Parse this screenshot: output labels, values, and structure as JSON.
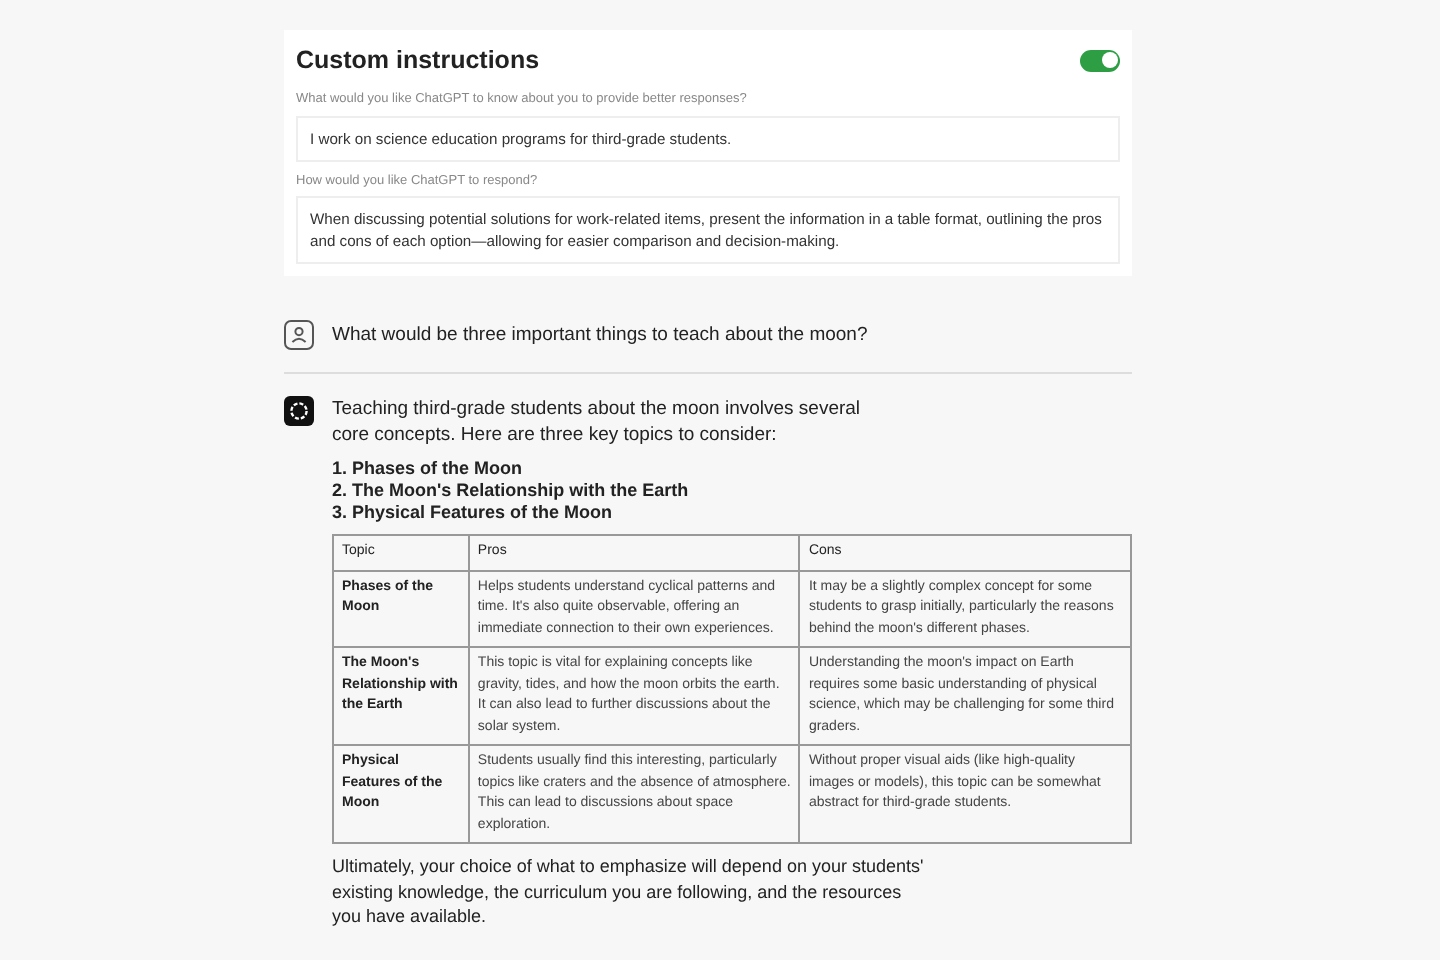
{
  "custom_instructions": {
    "title": "Custom instructions",
    "enabled": true,
    "fields": [
      {
        "label": "What would you like ChatGPT to know about you to provide better responses?",
        "value": "I work on science education programs for third-grade students."
      },
      {
        "label": "How would you like ChatGPT to respond?",
        "value": "When discussing potential solutions for work-related items, present the information in a table format, outlining the pros and cons of each option—allowing for easier comparison and decision-making."
      }
    ]
  },
  "user_message": {
    "text": "What would be three important things to teach about the moon?"
  },
  "assistant_message": {
    "intro": "Teaching third-grade students about the moon involves several core concepts. Here are three key topics to consider:",
    "list": [
      "1. Phases of the Moon",
      "2. The Moon's Relationship with the Earth",
      "3. Physical Features of the Moon"
    ],
    "table": {
      "columns": [
        "Topic",
        "Pros",
        "Cons"
      ],
      "rows": [
        [
          "Phases of the Moon",
          "Helps students understand cyclical patterns and time. It's also quite observable, offering an immediate connection to their own experiences.",
          "It may be a slightly complex concept for some students to grasp initially, particularly the reasons behind the moon's different phases."
        ],
        [
          "The Moon's Relationship with the Earth",
          "This topic is vital for explaining concepts like gravity, tides, and how the moon orbits the earth. It can also lead to further discussions about the solar system.",
          "Understanding the moon's impact on Earth requires some basic understanding of physical science, which may be challenging for some third graders."
        ],
        [
          "Physical Features of the Moon",
          "Students usually find this interesting, particularly topics like craters and the absence of atmosphere. This can lead to discussions about space exploration.",
          "Without proper visual aids (like high-quality images or models), this topic can be somewhat abstract for third-grade students."
        ]
      ]
    },
    "outro": "Ultimately, your choice of what to emphasize will depend on your students' existing knowledge, the curriculum you are following, and the resources you have available."
  }
}
